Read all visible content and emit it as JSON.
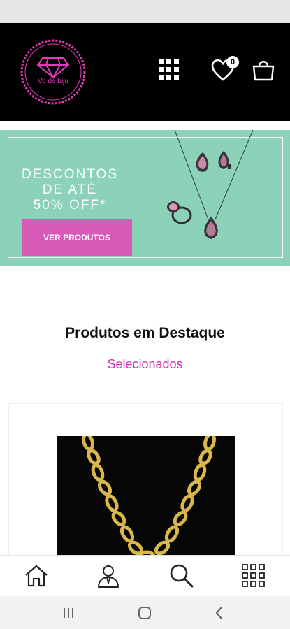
{
  "header": {
    "logo_text": "Vo de biju",
    "wishlist_count": "0"
  },
  "banner": {
    "headline_lines": [
      "DESCONTOS",
      "DE ATÉ",
      "50% OFF*"
    ],
    "cta_label": "VER PRODUTOS"
  },
  "featured": {
    "title": "Produtos em Destaque",
    "subtitle": "Selecionados"
  },
  "bottom_nav": {
    "items": [
      "home-icon",
      "user-icon",
      "search-icon",
      "apps-grid-icon"
    ]
  },
  "system_nav": {
    "items": [
      "recent-apps-icon",
      "home-button-icon",
      "back-icon"
    ]
  },
  "colors": {
    "header_bg": "#000000",
    "brand_pink": "#e23bb6",
    "banner_bg": "#8bd2b9",
    "cta_bg": "#d65ab8",
    "subtitle_pink": "#d62db3"
  }
}
